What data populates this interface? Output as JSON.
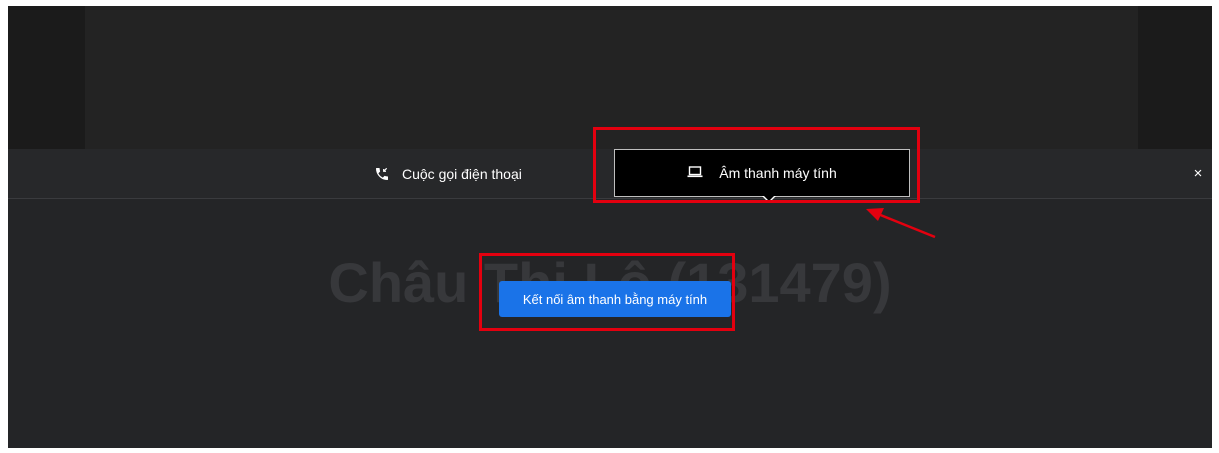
{
  "tabs": {
    "phone_label": "Cuộc gọi điện thoại",
    "computer_label": "Âm thanh máy tính",
    "close_glyph": "×"
  },
  "main": {
    "background_name": "Châu Thị Lộ (131479)",
    "connect_button_label": "Kết nối âm thanh bằng máy tính"
  },
  "icons": {
    "phone": "phone-callback-icon",
    "computer": "laptop-icon"
  },
  "colors": {
    "accent": "#1a73e8",
    "highlight": "#e3000f",
    "background": "#242527",
    "selected_tab": "#000000"
  }
}
